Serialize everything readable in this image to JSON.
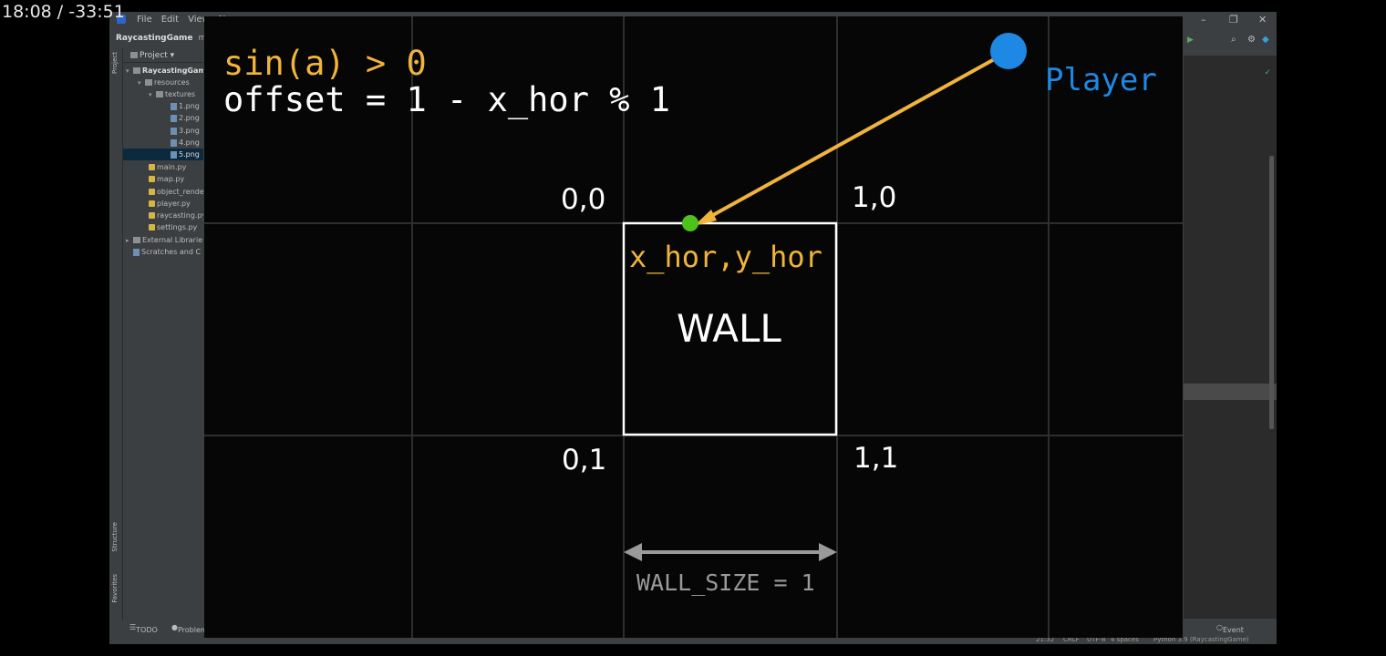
{
  "video": {
    "timestamp": "18:08 / -33:51"
  },
  "ide": {
    "menu": [
      "File",
      "Edit",
      "View",
      "Na"
    ],
    "breadcrumb": {
      "project": "RaycastingGame",
      "sub": "m"
    },
    "project_panel": {
      "header": "Project",
      "items": [
        {
          "label": "RaycastingGam",
          "kind": "root"
        },
        {
          "label": "resources",
          "kind": "folder"
        },
        {
          "label": "textures",
          "kind": "folder"
        },
        {
          "label": "1.png",
          "kind": "image"
        },
        {
          "label": "2.png",
          "kind": "image"
        },
        {
          "label": "3.png",
          "kind": "image"
        },
        {
          "label": "4.png",
          "kind": "image"
        },
        {
          "label": "5.png",
          "kind": "image"
        },
        {
          "label": "main.py",
          "kind": "python"
        },
        {
          "label": "map.py",
          "kind": "python"
        },
        {
          "label": "object_rende",
          "kind": "python"
        },
        {
          "label": "player.py",
          "kind": "python"
        },
        {
          "label": "raycasting.py",
          "kind": "python"
        },
        {
          "label": "settings.py",
          "kind": "python"
        },
        {
          "label": "External Librarie",
          "kind": "library"
        },
        {
          "label": "Scratches and C",
          "kind": "scratch"
        }
      ]
    },
    "side_tabs": {
      "project": "Project",
      "structure": "Structure",
      "favorites": "Favorites"
    },
    "bottom_tabs": {
      "todo": "TODO",
      "problems": "Problem",
      "event_log": "Event Log"
    },
    "status": {
      "position": "21:32",
      "line_sep": "CRLF",
      "encoding": "UTF-8",
      "indent": "4 spaces",
      "interpreter": "Python 3.9 (RaycastingGame)"
    }
  },
  "slide": {
    "formula_line1": "sin(a) > 0",
    "formula_line2": "offset = 1 - x_hor % 1",
    "player_label": "Player",
    "coords": {
      "c00": "0,0",
      "c10": "1,0",
      "c01": "0,1",
      "c11": "1,1"
    },
    "hit_label": "x_hor,y_hor",
    "wall_label": "WALL",
    "wall_size_label": "WALL_SIZE = 1",
    "colors": {
      "player": "#1e88e5",
      "ray": "#f0b43a",
      "hit_point": "#4cc21a",
      "grid": "#2e2e2e",
      "wall": "#ffffff"
    }
  }
}
